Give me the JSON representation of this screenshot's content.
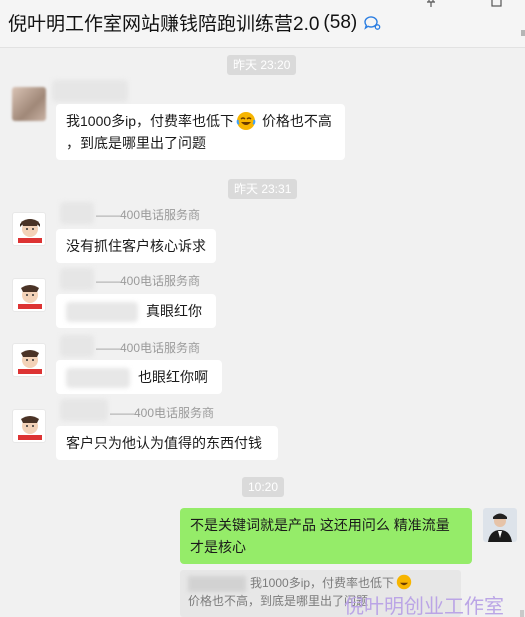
{
  "window": {
    "title": "倪叶明工作室网站赚钱陪跑训练营2.0",
    "member_count": "(58)"
  },
  "messages": {
    "time1": "昨天 23:20",
    "m1_text": "我1000多ip，付费率也低下",
    "m1_text_b": "价格也不高",
    "m1_text_c": "，到底是哪里出了问题",
    "time2": "昨天 23:31",
    "nick_suffix": "——400电话服务商",
    "m2_text": "没有抓住客户核心诉求",
    "m3_text": "真眼红你",
    "m4_text": "也眼红你啊",
    "m5_text": "客户只为他认为值得的东西付钱",
    "time3": "10:20",
    "self_text_1": "不是关键词就是产品  这还用问么   精准流量",
    "self_text_2": "才是核心",
    "quote_line1": "我1000多ip，付费率也低下",
    "quote_line2": "价格也不高，到底是哪里出了问题"
  },
  "watermark": {
    "text": "倪叶明创业工作室"
  },
  "colors": {
    "background": "#f1f1f1",
    "bubble_self": "#95ec69",
    "bubble_other": "#ffffff",
    "time_badge": "#dadada",
    "watermark": "#b9a2e6"
  },
  "icons": [
    "chat-bubbles-icon",
    "pin-icon",
    "maximize-icon",
    "laughing-tears-emoji"
  ]
}
